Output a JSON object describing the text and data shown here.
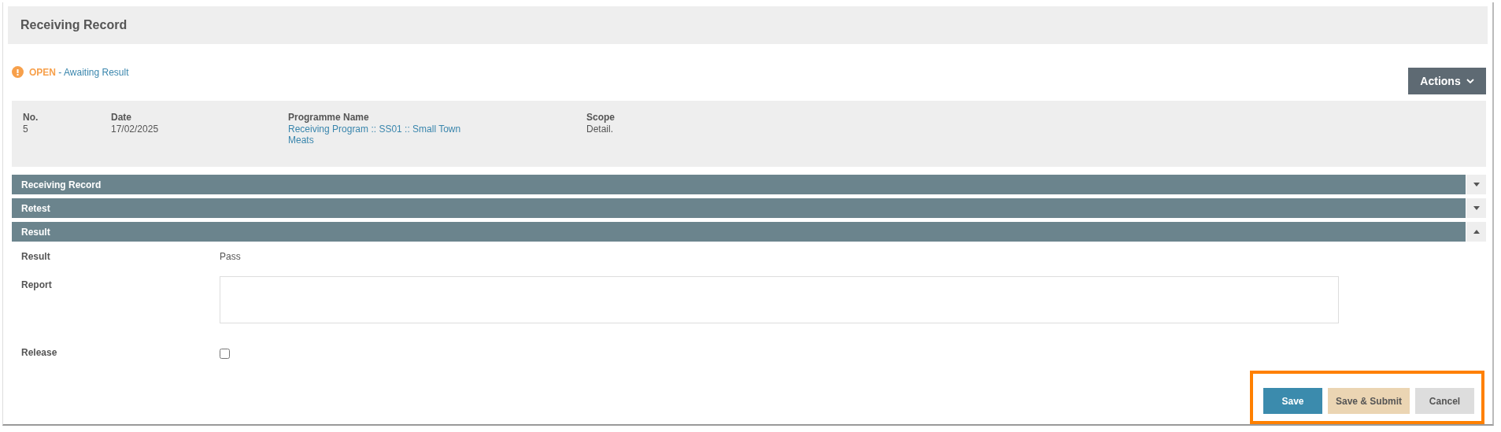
{
  "header": {
    "title": "Receiving Record"
  },
  "status": {
    "state": "OPEN",
    "separator": " - ",
    "description": "Awaiting Result"
  },
  "actions_button": {
    "label": "Actions"
  },
  "summary": [
    {
      "label": "No.",
      "value": "5",
      "kind": "text"
    },
    {
      "label": "Date",
      "value": "17/02/2025",
      "kind": "text"
    },
    {
      "label": "Programme Name",
      "value": "Receiving Program :: SS01 :: Small Town Meats",
      "kind": "link"
    },
    {
      "label": "Scope",
      "value": "Detail.",
      "kind": "text"
    }
  ],
  "sections": [
    {
      "title": "Receiving Record",
      "expanded": false
    },
    {
      "title": "Retest",
      "expanded": false
    },
    {
      "title": "Result",
      "expanded": true
    }
  ],
  "fields": [
    {
      "label": "Result",
      "kind": "text",
      "value": "Pass"
    },
    {
      "label": "Report",
      "kind": "textarea"
    },
    {
      "label": "Release",
      "kind": "checkbox",
      "checked": false
    }
  ],
  "buttons": [
    {
      "label": "Save",
      "kind": "primary"
    },
    {
      "label": "Save & Submit",
      "kind": "submit"
    },
    {
      "label": "Cancel",
      "kind": "cancel"
    }
  ]
}
